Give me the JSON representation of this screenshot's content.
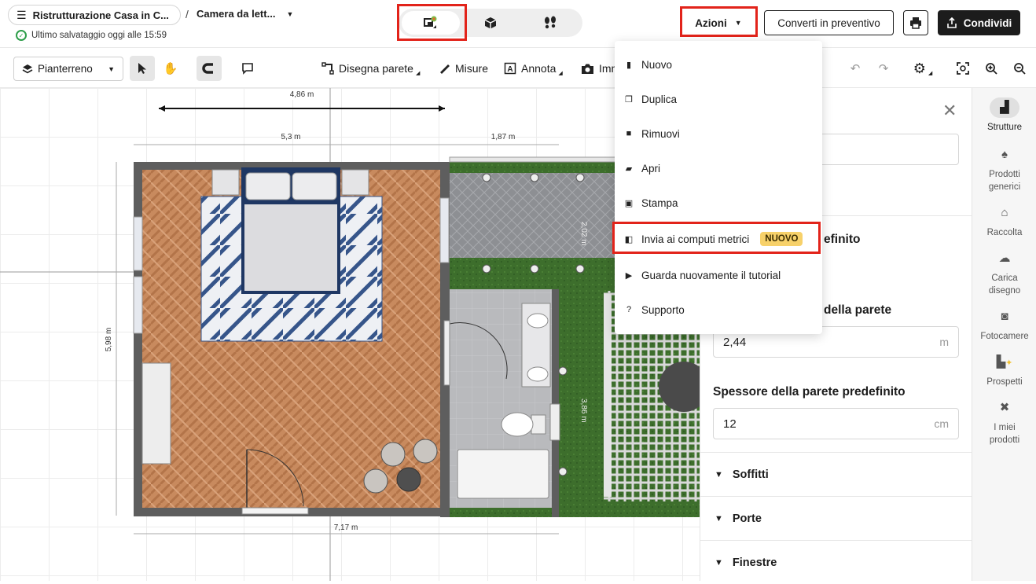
{
  "header": {
    "menu_icon": "hamburger-icon",
    "project_name": "Ristrutturazione Casa in C...",
    "separator": "/",
    "room_name": "Camera da lett...",
    "save_status": "Ultimo salvataggio oggi alle 15:59",
    "view_modes": [
      "2d-plan-icon",
      "3d-box-icon",
      "walkthrough-footsteps-icon"
    ],
    "actions_label": "Azioni",
    "quote_label": "Converti in preventivo",
    "print_icon": "printer-icon",
    "share_label": "Condividi"
  },
  "toolbar": {
    "floor": "Pianterreno",
    "draw_wall": "Disegna parete",
    "measures": "Misure",
    "annotate": "Annota",
    "image_partial": "Imm"
  },
  "dimensions": {
    "top_arrow": "4,86 m",
    "room_width": "5,3 m",
    "garden_width": "1,87 m",
    "room_height": "5,98 m",
    "total_width": "7,17 m",
    "vertical_a": "2,02 m",
    "vertical_b": "3,86 m"
  },
  "panel": {
    "partial_title": "efinito",
    "wall_height_label": "della parete",
    "wall_height_value": "2,44",
    "wall_height_unit": "m",
    "wall_thickness_label": "Spessore della parete predefinito",
    "wall_thickness_value": "12",
    "wall_thickness_unit": "cm",
    "sections": [
      "Soffitti",
      "Porte",
      "Finestre"
    ]
  },
  "sidebar": {
    "items": [
      {
        "label": "Strutture",
        "icon": "stairs-icon"
      },
      {
        "label": "Prodotti generici",
        "icon": "generic-products-icon"
      },
      {
        "label": "Raccolta",
        "icon": "collection-house-icon"
      },
      {
        "label": "Carica disegno",
        "icon": "upload-cloud-icon"
      },
      {
        "label": "Fotocamere",
        "icon": "camera-icon"
      },
      {
        "label": "Prospetti",
        "icon": "elevations-icon"
      },
      {
        "label": "I miei prodotti",
        "icon": "my-products-icon"
      }
    ]
  },
  "menu": {
    "items": [
      {
        "label": "Nuovo",
        "icon": "new-file-icon"
      },
      {
        "label": "Duplica",
        "icon": "duplicate-icon"
      },
      {
        "label": "Rimuovi",
        "icon": "trash-icon"
      },
      {
        "label": "Apri",
        "icon": "folder-icon"
      },
      {
        "label": "Stampa",
        "icon": "printer-icon"
      },
      {
        "label": "Invia ai computi metrici",
        "icon": "send-estimate-icon",
        "badge": "NUOVO"
      },
      {
        "label": "Guarda nuovamente il tutorial",
        "icon": "play-icon"
      },
      {
        "label": "Supporto",
        "icon": "help-icon"
      }
    ]
  },
  "colors": {
    "highlight": "#e2231a",
    "badge": "#f7d16a",
    "primary_dark": "#1c1c1c",
    "success": "#2e9e4a"
  }
}
